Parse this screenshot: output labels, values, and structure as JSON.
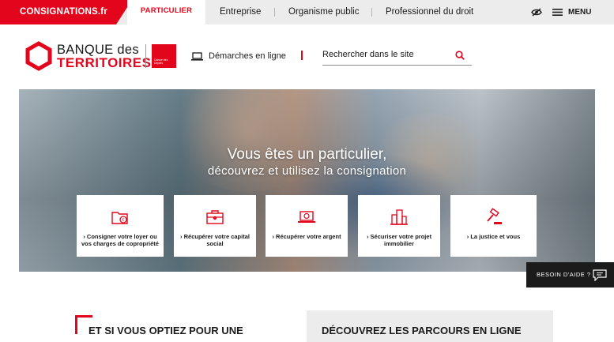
{
  "topbar": {
    "brand": "CONSIGNATIONS.fr",
    "active_tab": "PARTICULIER",
    "tabs": [
      "Entreprise",
      "Organisme public",
      "Professionnel du droit"
    ],
    "menu_label": "MENU"
  },
  "header": {
    "logo_line1": "BANQUE des",
    "logo_line2": "TERRITOIRES",
    "cdc_text": "Caisse des Dépôts",
    "demarches_label": "Démarches en ligne",
    "search_placeholder": "Rechercher dans le site"
  },
  "hero": {
    "title": "Vous êtes un particulier,",
    "subtitle": "découvrez et utilisez la consignation",
    "cards": [
      {
        "icon": "folder-euro-icon",
        "label": "Consigner votre loyer ou vos charges de copropriété"
      },
      {
        "icon": "briefcase-icon",
        "label": "Récupérer votre capital social"
      },
      {
        "icon": "laptop-euro-icon",
        "label": "Récupérer votre argent"
      },
      {
        "icon": "buildings-icon",
        "label": "Sécuriser votre projet immobilier"
      },
      {
        "icon": "gavel-icon",
        "label": "La justice et vous"
      }
    ]
  },
  "help": {
    "label": "BESOIN D'AIDE ?"
  },
  "sections": {
    "left_heading": "ET SI VOUS OPTIEZ POUR UNE",
    "right_heading": "DÉCOUVREZ LES PARCOURS EN LIGNE"
  },
  "colors": {
    "brand_red": "#e3051b",
    "topbar_bg": "#ececec",
    "dark": "#1b1b1b"
  }
}
